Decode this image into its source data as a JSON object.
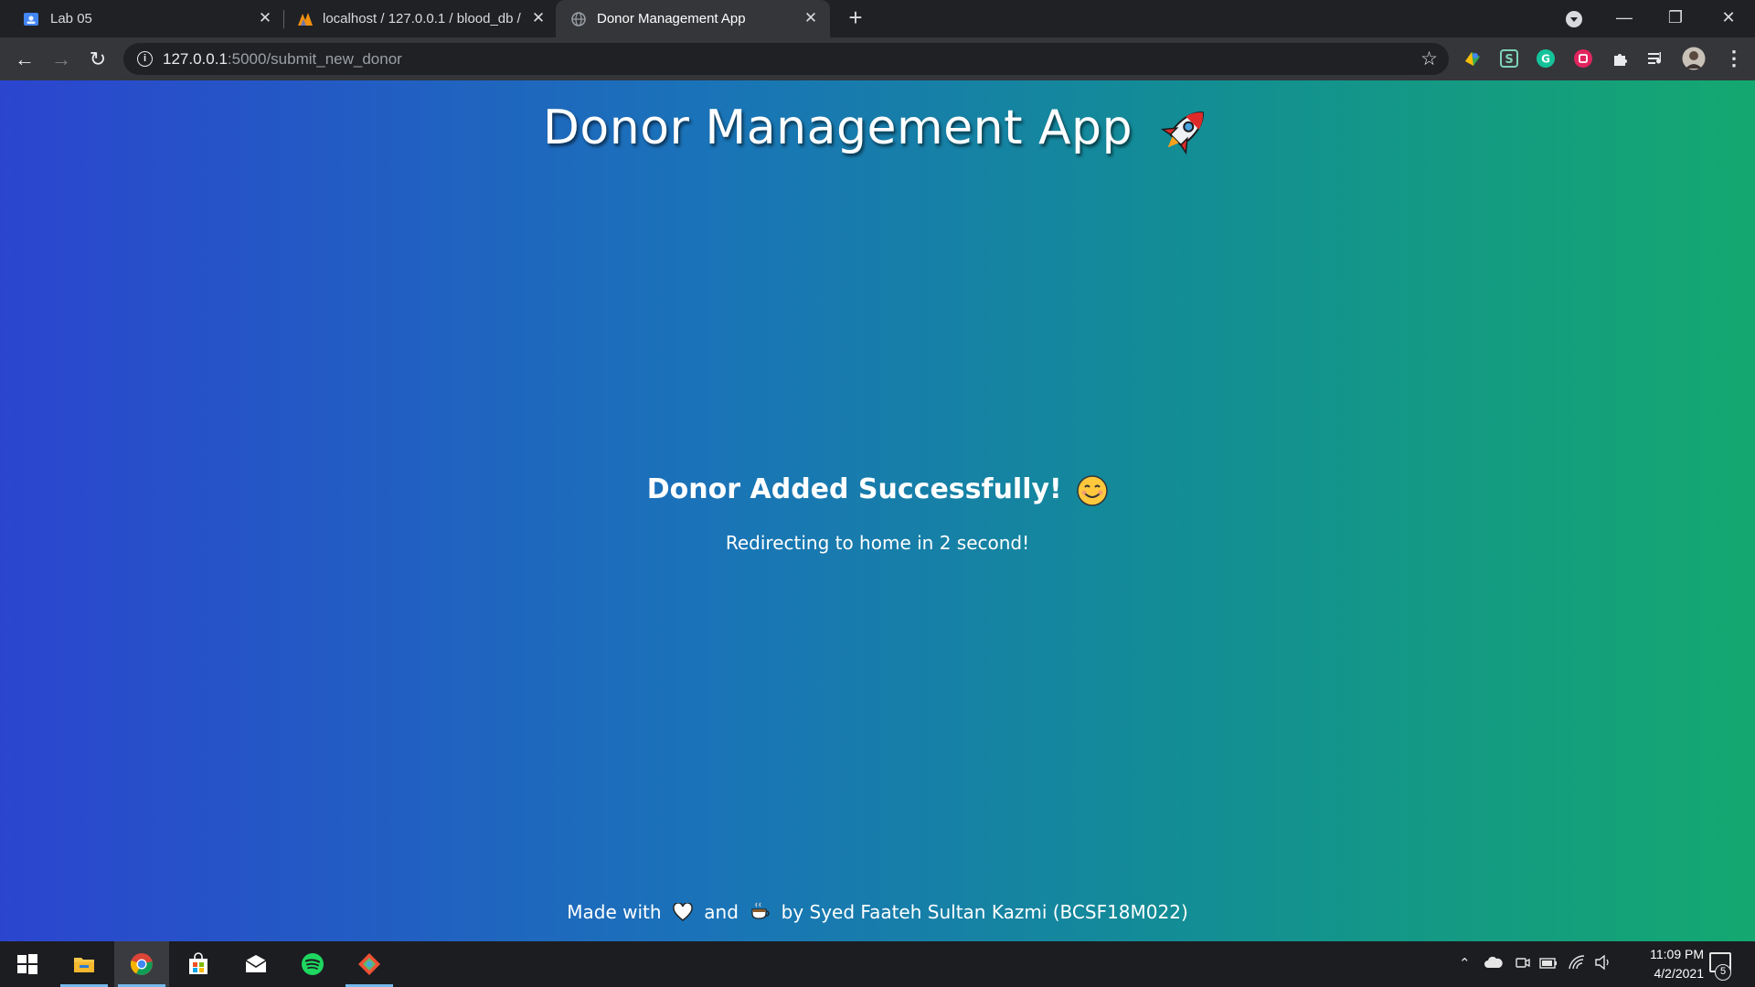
{
  "browser": {
    "tabs": [
      {
        "title": "Lab 05",
        "active": false
      },
      {
        "title": "localhost / 127.0.0.1 / blood_db /",
        "active": false
      },
      {
        "title": "Donor Management App",
        "active": true
      }
    ],
    "address_host": "127.0.0.1",
    "address_path": ":5000/submit_new_donor",
    "new_tab_label": "+",
    "close_label": "✕"
  },
  "page": {
    "app_title": "Donor Management App",
    "message": "Donor Added Successfully!",
    "redirect_text": "Redirecting to home in 2 second!",
    "footer": {
      "made_with": "Made with",
      "and": "and",
      "by": "by Syed Faateh Sultan Kazmi (BCSF18M022)"
    }
  },
  "taskbar": {
    "time": "11:09 PM",
    "date": "4/2/2021",
    "notification_count": "5"
  },
  "colors": {
    "gradient_left": "#2b45cf",
    "gradient_right": "#14a870",
    "browser_chrome": "#35363a"
  }
}
